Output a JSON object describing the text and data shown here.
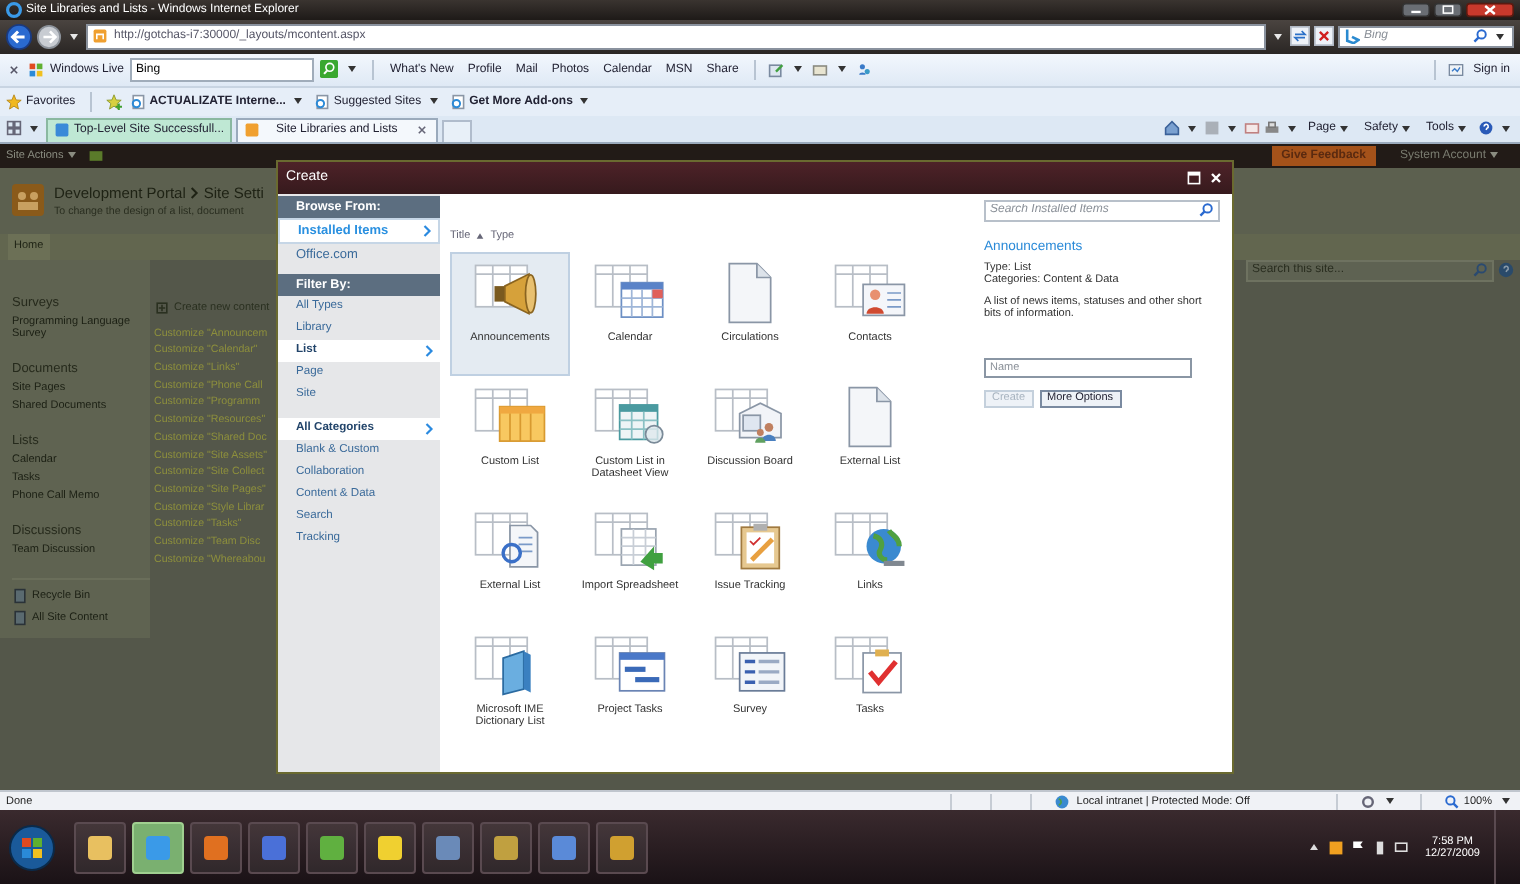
{
  "window": {
    "title": "Site Libraries and Lists - Windows Internet Explorer"
  },
  "address_bar": {
    "url": "http://gotchas-i7:30000/_layouts/mcontent.aspx",
    "search_placeholder": "Bing"
  },
  "live_toolbar": {
    "brand": "Windows Live",
    "search_value": "Bing",
    "links": [
      "What's New",
      "Profile",
      "Mail",
      "Photos",
      "Calendar",
      "MSN",
      "Share"
    ],
    "sign_in": "Sign in"
  },
  "favorites_bar": {
    "favorites": "Favorites",
    "items": [
      {
        "label": "ACTUALIZATE Interne...",
        "bold": true
      },
      {
        "label": "Suggested Sites",
        "bold": false
      },
      {
        "label": "Get More Add-ons",
        "bold": true
      }
    ]
  },
  "tabs": [
    {
      "label": "Top-Level Site Successfull...",
      "selected": false
    },
    {
      "label": "Site Libraries and Lists",
      "selected": true
    }
  ],
  "command_bar": [
    "Page",
    "Safety",
    "Tools"
  ],
  "page": {
    "site_actions": "Site Actions",
    "feedback": "Give Feedback",
    "account": "System Account",
    "breadcrumb": [
      "Development Portal",
      "Site Setti"
    ],
    "subtitle": "To change the design of a list, document",
    "home": "Home",
    "search_placeholder": "Search this site...",
    "quick_launch": [
      {
        "heading": "Surveys",
        "items": [
          "Programming Language Survey"
        ]
      },
      {
        "heading": "Documents",
        "items": [
          "Site Pages",
          "Shared Documents"
        ]
      },
      {
        "heading": "Lists",
        "items": [
          "Calendar",
          "Tasks",
          "Phone Call Memo"
        ]
      },
      {
        "heading": "Discussions",
        "items": [
          "Team Discussion"
        ]
      }
    ],
    "footer_links": [
      "Recycle Bin",
      "All Site Content"
    ],
    "create_link": "Create new content",
    "customize_links": [
      "Customize \"Announcem",
      "Customize \"Calendar\"",
      "Customize \"Links\"",
      "Customize \"Phone Call",
      "Customize \"Programm",
      "Customize \"Resources\"",
      "Customize \"Shared Doc",
      "Customize \"Site Assets\"",
      "Customize \"Site Collect",
      "Customize \"Site Pages\"",
      "Customize \"Style Librar",
      "Customize \"Tasks\"",
      "Customize \"Team Disc",
      "Customize \"Whereabou"
    ]
  },
  "dialog": {
    "title": "Create",
    "browse_from": {
      "heading": "Browse From:",
      "items": [
        {
          "label": "Installed Items",
          "selected": true
        },
        {
          "label": "Office.com",
          "selected": false
        }
      ]
    },
    "filter_by": {
      "heading": "Filter By:",
      "types": [
        {
          "label": "All Types",
          "selected": false
        },
        {
          "label": "Library",
          "selected": false
        },
        {
          "label": "List",
          "selected": true
        },
        {
          "label": "Page",
          "selected": false
        },
        {
          "label": "Site",
          "selected": false
        }
      ],
      "categories": [
        {
          "label": "All Categories",
          "selected": true
        },
        {
          "label": "Blank & Custom",
          "selected": false
        },
        {
          "label": "Collaboration",
          "selected": false
        },
        {
          "label": "Content & Data",
          "selected": false
        },
        {
          "label": "Search",
          "selected": false
        },
        {
          "label": "Tracking",
          "selected": false
        }
      ]
    },
    "sort": [
      "Title",
      "Type"
    ],
    "templates": [
      {
        "label": "Announcements",
        "selected": true
      },
      {
        "label": "Calendar",
        "selected": false
      },
      {
        "label": "Circulations",
        "selected": false
      },
      {
        "label": "Contacts",
        "selected": false
      },
      {
        "label": "Custom List",
        "selected": false
      },
      {
        "label": "Custom List in Datasheet View",
        "selected": false
      },
      {
        "label": "Discussion Board",
        "selected": false
      },
      {
        "label": "External List",
        "selected": false
      },
      {
        "label": "External List",
        "selected": false
      },
      {
        "label": "Import Spreadsheet",
        "selected": false
      },
      {
        "label": "Issue Tracking",
        "selected": false
      },
      {
        "label": "Links",
        "selected": false
      },
      {
        "label": "Microsoft IME Dictionary List",
        "selected": false
      },
      {
        "label": "Project Tasks",
        "selected": false
      },
      {
        "label": "Survey",
        "selected": false
      },
      {
        "label": "Tasks",
        "selected": false
      }
    ],
    "search_placeholder": "Search Installed Items",
    "detail": {
      "title": "Announcements",
      "type": "Type: List",
      "categories": "Categories: Content & Data",
      "description": "A list of news items, statuses and other short bits of information."
    },
    "name_placeholder": "Name",
    "buttons": [
      {
        "label": "Create",
        "disabled": true
      },
      {
        "label": "More Options",
        "disabled": false
      }
    ]
  },
  "status_bar": {
    "text": "Done",
    "zone": "Local intranet | Protected Mode: Off",
    "zoom": "100%"
  },
  "taskbar": {
    "time": "7:58 PM",
    "date": "12/27/2009"
  }
}
